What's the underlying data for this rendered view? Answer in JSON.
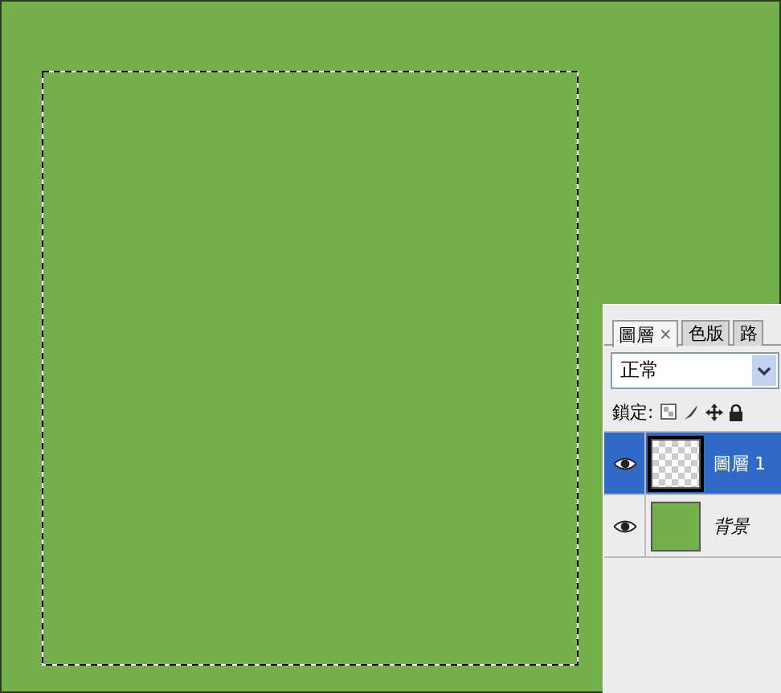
{
  "canvas": {
    "selection": true
  },
  "layers_panel": {
    "tabs": [
      {
        "label": "圖層",
        "selected": true,
        "close": "×"
      },
      {
        "label": "色版",
        "selected": false
      },
      {
        "label": "路",
        "selected": false
      }
    ],
    "blend_mode": "正常",
    "lock_label": "鎖定:",
    "layers": [
      {
        "name": "圖層 1",
        "selected": true,
        "visible": true,
        "kind": "transparent"
      },
      {
        "name": "背景",
        "selected": false,
        "visible": true,
        "kind": "fill",
        "color": "#74b04b"
      }
    ]
  }
}
